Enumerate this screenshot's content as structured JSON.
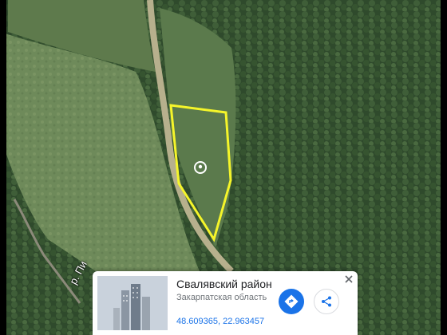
{
  "map": {
    "type": "satellite",
    "river_label": "р. Пи",
    "plot_outline_color": "#f5f52a",
    "pin": "location-pin-icon"
  },
  "place_card": {
    "title": "Свалявский район",
    "subtitle": "Закарпатская область",
    "coordinates": "48.609365, 22.963457",
    "directions_icon": "directions-icon",
    "share_icon": "share-icon",
    "close_icon": "close-icon",
    "accent_color": "#1a73e8"
  }
}
